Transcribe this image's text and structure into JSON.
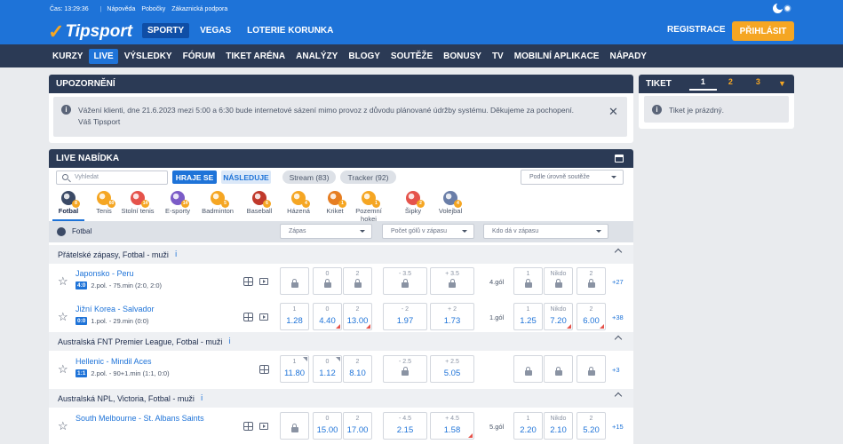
{
  "topbar": {
    "time": "Čas: 13:29:36",
    "links": [
      "Nápověda",
      "Pobočky",
      "Zákaznická podpora"
    ]
  },
  "header": {
    "logo": "Tipsport",
    "nav": [
      "SPORTY",
      "VEGAS",
      "LOTERIE KORUNKA"
    ],
    "register": "REGISTRACE",
    "login": "PŘIHLÁSIT"
  },
  "nav2": [
    "KURZY",
    "LIVE",
    "VÝSLEDKY",
    "FÓRUM",
    "TIKET ARÉNA",
    "ANALÝZY",
    "BLOGY",
    "SOUTĚŽE",
    "BONUSY",
    "TV",
    "MOBILNÍ APLIKACE",
    "NÁPADY"
  ],
  "notice": {
    "title": "UPOZORNĚNÍ",
    "line1": "Vážení klienti, dne 21.6.2023 mezi 5:00 a 6:30 bude internetové sázení mimo provoz z důvodu plánované údržby systému. Děkujeme za pochopení.",
    "line2": "Váš Tipsport"
  },
  "ticket": {
    "title": "TIKET",
    "tabs": [
      "1",
      "2",
      "3"
    ],
    "empty": "Tiket je prázdný."
  },
  "live": {
    "title": "LIVE NABÍDKA",
    "search_placeholder": "Vyhledat",
    "hraje_se": "HRAJE SE",
    "nasleduje": "NÁSLEDUJE",
    "stream": "Stream (83)",
    "tracker": "Tracker (92)",
    "sort": "Podle úrovně soutěže",
    "sports": [
      {
        "name": "Fotbal",
        "count": "8",
        "color": "#3b4a66"
      },
      {
        "name": "Tenis",
        "count": "60",
        "color": "#f5a623"
      },
      {
        "name": "Stolní tenis",
        "count": "14",
        "color": "#e5534b"
      },
      {
        "name": "E-sporty",
        "count": "14",
        "color": "#7b5cc7"
      },
      {
        "name": "Badminton",
        "count": "5",
        "color": "#f5a623"
      },
      {
        "name": "Baseball",
        "count": "6",
        "color": "#c0392b"
      },
      {
        "name": "Házená",
        "count": "4",
        "color": "#f5a623"
      },
      {
        "name": "Kriket",
        "count": "1",
        "color": "#e67e22"
      },
      {
        "name": "Pozemní hokej",
        "count": "1",
        "color": "#f5a623"
      },
      {
        "name": "Šipky",
        "count": "2",
        "color": "#e5534b"
      },
      {
        "name": "Volejbal",
        "count": "4",
        "color": "#6a7ea8"
      }
    ],
    "filter_sport": "Fotbal",
    "filters": [
      "Zápas",
      "Počet gólů v zápasu",
      "Kdo dá v zápasu"
    ],
    "sections": [
      {
        "title": "Přátelské zápasy, Fotbal - muži"
      },
      {
        "title": "Australská FNT Premier League, Fotbal - muži"
      },
      {
        "title": "Australská NPL, Victoria, Fotbal - muži"
      }
    ],
    "matches": [
      {
        "name": "Japonsko - Peru",
        "score": "4:0",
        "info": "2.pol. - 75.min (2:0, 2:0)",
        "odds": [
          {
            "l": "",
            "v": ""
          },
          {
            "l": "0",
            "v": ""
          },
          {
            "l": "2",
            "v": ""
          }
        ],
        "ou": [
          {
            "l": "- 3.5",
            "v": ""
          },
          {
            "l": "+ 3.5",
            "v": ""
          }
        ],
        "goal": "4.gól",
        "gs": [
          {
            "l": "1",
            "v": ""
          },
          {
            "l": "Nikdo",
            "v": ""
          },
          {
            "l": "2",
            "v": ""
          }
        ],
        "more": "+27"
      },
      {
        "name": "Jižní Korea - Salvador",
        "score": "0:0",
        "info": "1.pol. - 29.min (0:0)",
        "odds": [
          {
            "l": "1",
            "v": "1.28"
          },
          {
            "l": "0",
            "v": "4.40"
          },
          {
            "l": "2",
            "v": "13.00"
          }
        ],
        "ou": [
          {
            "l": "- 2",
            "v": "1.97"
          },
          {
            "l": "+ 2",
            "v": "1.73"
          }
        ],
        "goal": "1.gól",
        "gs": [
          {
            "l": "1",
            "v": "1.25"
          },
          {
            "l": "Nikdo",
            "v": "7.20"
          },
          {
            "l": "2",
            "v": "6.00"
          }
        ],
        "more": "+38"
      },
      {
        "name": "Hellenic - Mindil Aces",
        "score": "1:1",
        "info": "2.pol. - 90+1.min (1:1, 0:0)",
        "odds": [
          {
            "l": "1",
            "v": "11.80"
          },
          {
            "l": "0",
            "v": "1.12"
          },
          {
            "l": "2",
            "v": "8.10"
          }
        ],
        "ou": [
          {
            "l": "- 2.5",
            "v": ""
          },
          {
            "l": "+ 2.5",
            "v": "5.05"
          }
        ],
        "goal": "",
        "gs": [
          {
            "l": "",
            "v": ""
          },
          {
            "l": "",
            "v": ""
          },
          {
            "l": "",
            "v": ""
          }
        ],
        "more": "+3"
      },
      {
        "name": "South Melbourne - St. Albans Saints",
        "score": "",
        "info": "",
        "odds": [
          {
            "l": "",
            "v": ""
          },
          {
            "l": "0",
            "v": "15.00"
          },
          {
            "l": "2",
            "v": "17.00"
          }
        ],
        "ou": [
          {
            "l": "- 4.5",
            "v": "2.15"
          },
          {
            "l": "+ 4.5",
            "v": "1.58"
          }
        ],
        "goal": "5.gól",
        "gs": [
          {
            "l": "1",
            "v": "2.20"
          },
          {
            "l": "Nikdo",
            "v": "2.10"
          },
          {
            "l": "2",
            "v": "5.20"
          }
        ],
        "more": "+15"
      }
    ]
  }
}
